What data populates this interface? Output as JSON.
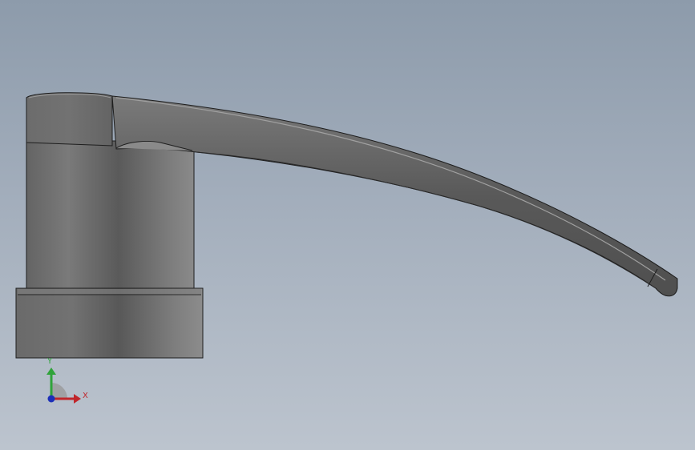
{
  "viewport": {
    "background_top": "#8d9bab",
    "background_bottom": "#bcc4ce"
  },
  "model": {
    "body_color": "#6f6f6f",
    "edge_color": "#1e1e1e"
  },
  "triad": {
    "x_label": "X",
    "y_label": "Y",
    "x_color": "#c0262b",
    "y_color": "#2fa33a",
    "z_color": "#1c2fb8"
  }
}
